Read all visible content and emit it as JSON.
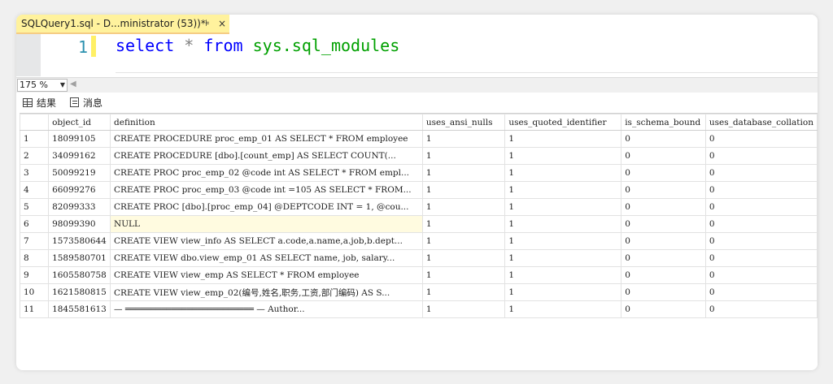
{
  "tab": {
    "title": "SQLQuery1.sql - D...ministrator (53))*",
    "pin": "⊧",
    "close": "×"
  },
  "editor": {
    "line_number": "1",
    "code": {
      "kw_select": "select",
      "op_star": "*",
      "kw_from": "from",
      "obj": "sys.",
      "obj2": "sql_modules"
    }
  },
  "zoom": {
    "value": "175 %"
  },
  "results_tabs": {
    "results": "结果",
    "messages": "消息"
  },
  "grid": {
    "columns": [
      "object_id",
      "definition",
      "uses_ansi_nulls",
      "uses_quoted_identifier",
      "is_schema_bound",
      "uses_database_collation"
    ],
    "rows": [
      {
        "n": "1",
        "object_id": "18099105",
        "definition": "CREATE PROCEDURE proc_emp_01 AS    SELECT * FROM employee",
        "ansi": "1",
        "quoted": "1",
        "schema": "0",
        "coll": "0"
      },
      {
        "n": "2",
        "object_id": "34099162",
        "definition": "  CREATE PROCEDURE [dbo].[count_emp]  AS     SELECT COUNT(...",
        "ansi": "1",
        "quoted": "1",
        "schema": "0",
        "coll": "0"
      },
      {
        "n": "3",
        "object_id": "50099219",
        "definition": "CREATE PROC proc_emp_02 @code int AS    SELECT * FROM empl...",
        "ansi": "1",
        "quoted": "1",
        "schema": "0",
        "coll": "0"
      },
      {
        "n": "4",
        "object_id": "66099276",
        "definition": "CREATE PROC proc_emp_03 @code int =105 AS    SELECT * FROM...",
        "ansi": "1",
        "quoted": "1",
        "schema": "0",
        "coll": "0"
      },
      {
        "n": "5",
        "object_id": "82099333",
        "definition": "  CREATE PROC [dbo].[proc_emp_04]  @DEPTCODE INT = 1,  @cou...",
        "ansi": "1",
        "quoted": "1",
        "schema": "0",
        "coll": "0"
      },
      {
        "n": "6",
        "object_id": "98099390",
        "definition": "NULL",
        "ansi": "1",
        "quoted": "1",
        "schema": "0",
        "coll": "0",
        "is_null": true
      },
      {
        "n": "7",
        "object_id": "1573580644",
        "definition": "CREATE VIEW view_info AS  SELECT a.code,a.name,a.job,b.dept...",
        "ansi": "1",
        "quoted": "1",
        "schema": "0",
        "coll": "0"
      },
      {
        "n": "8",
        "object_id": "1589580701",
        "definition": "CREATE VIEW dbo.view_emp_01  AS  SELECT   name, job, salary...",
        "ansi": "1",
        "quoted": "1",
        "schema": "0",
        "coll": "0"
      },
      {
        "n": "9",
        "object_id": "1605580758",
        "definition": "CREATE VIEW view_emp AS  SELECT * FROM employee",
        "ansi": "1",
        "quoted": "1",
        "schema": "0",
        "coll": "0"
      },
      {
        "n": "10",
        "object_id": "1621580815",
        "definition": "CREATE VIEW view_emp_02(编号,姓名,职务,工资,部门编码) AS  S...",
        "ansi": "1",
        "quoted": "1",
        "schema": "0",
        "coll": "0"
      },
      {
        "n": "11",
        "object_id": "1845581613",
        "definition": "— ═════════════════════════  — Author...",
        "ansi": "1",
        "quoted": "1",
        "schema": "0",
        "coll": "0"
      }
    ]
  },
  "colors": {
    "tab_active": "#fff29d",
    "keyword": "#0000ff",
    "sys_object": "#00a000",
    "line_number": "#2b91af",
    "null_cell": "#fffbe0"
  }
}
